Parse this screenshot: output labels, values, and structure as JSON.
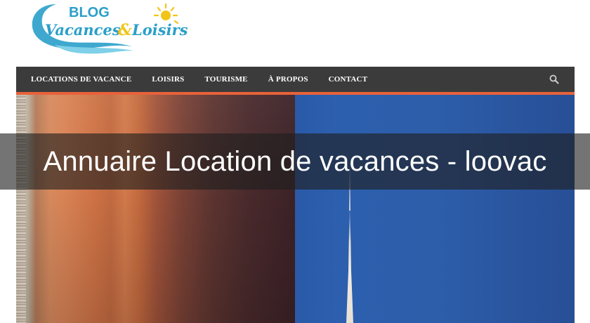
{
  "logo": {
    "line1": "BLOG",
    "line2": "Vacances",
    "ampersand": "&",
    "line3": "Loisirs",
    "colors": {
      "primary": "#2a9fc9",
      "sun": "#f2c418",
      "wave": "#7fd0e8"
    }
  },
  "nav": {
    "items": [
      {
        "label": "LOCATIONS DE VACANCE"
      },
      {
        "label": "LOISIRS"
      },
      {
        "label": "TOURISME"
      },
      {
        "label": "À PROPOS"
      },
      {
        "label": "CONTACT"
      }
    ],
    "search_icon": "search-icon",
    "colors": {
      "bar": "#3b3b3b",
      "accent": "#e8623a"
    }
  },
  "hero": {
    "title": "Annuaire Location de vacances - loovac"
  }
}
